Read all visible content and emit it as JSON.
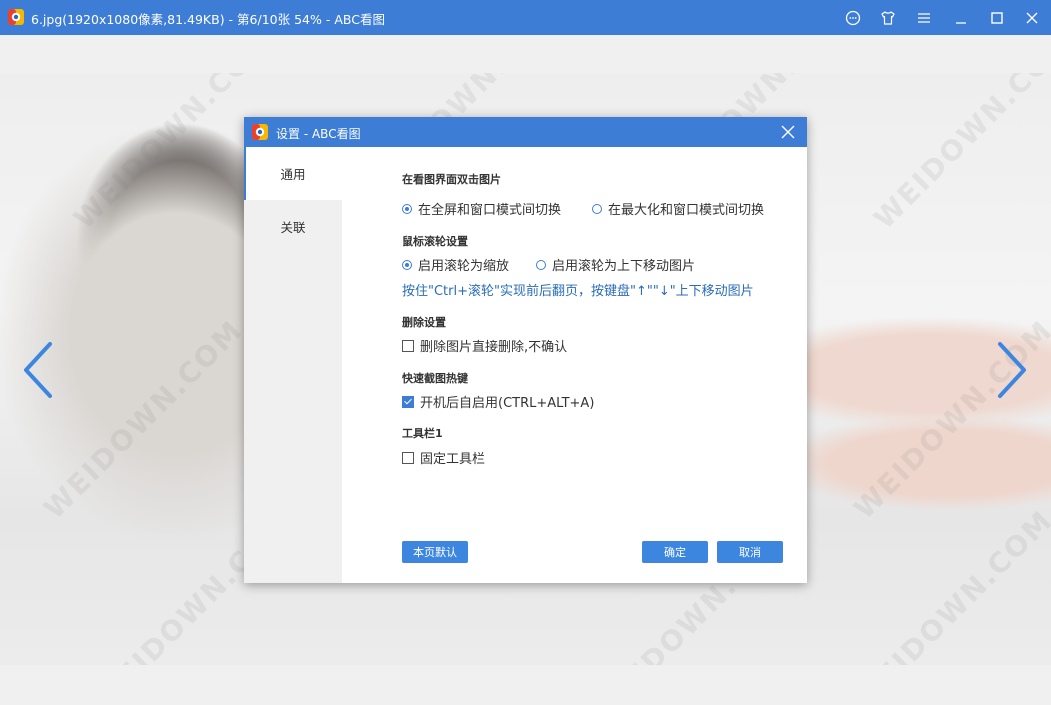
{
  "window": {
    "title": "6.jpg(1920x1080像素,81.49KB) - 第6/10张 54% - ABC看图",
    "controls": [
      "chat-icon",
      "skin-icon",
      "menu-icon",
      "minimize-icon",
      "maximize-icon",
      "close-icon"
    ]
  },
  "viewer": {
    "watermark": "WEIDOWN.COM"
  },
  "dialog": {
    "title": "设置 - ABC看图",
    "sidebar": {
      "items": [
        {
          "label": "通用",
          "active": true
        },
        {
          "label": "关联",
          "active": false
        }
      ]
    },
    "sections": {
      "double_click": {
        "heading": "在看图界面双击图片",
        "option1": "在全屏和窗口模式间切换",
        "option2": "在最大化和窗口模式间切换",
        "selected": 1
      },
      "wheel": {
        "heading": "鼠标滚轮设置",
        "option1": "启用滚轮为缩放",
        "option2": "启用滚轮为上下移动图片",
        "selected": 1,
        "hint": "按住\"Ctrl+滚轮\"实现前后翻页，按键盘\"↑\"\"↓\"上下移动图片"
      },
      "delete": {
        "heading": "删除设置",
        "option": "删除图片直接删除,不确认",
        "checked": false
      },
      "screenshot": {
        "heading": "快速截图热键",
        "option": "开机后自启用(CTRL+ALT+A)",
        "checked": true
      },
      "toolbar": {
        "heading": "工具栏1",
        "option": "固定工具栏",
        "checked": false
      }
    },
    "buttons": {
      "default": "本页默认",
      "ok": "确定",
      "cancel": "取消"
    }
  },
  "colors": {
    "accent": "#3d7dd6",
    "hint": "#2a6db8"
  }
}
